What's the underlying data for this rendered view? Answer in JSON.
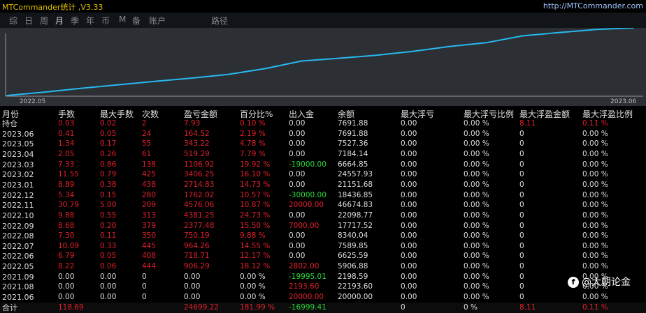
{
  "app": {
    "title": "MTCommander统计 ,V3.33",
    "link": "http://MTCommander.com"
  },
  "tabs": [
    {
      "label": "综"
    },
    {
      "label": "日"
    },
    {
      "label": "周"
    },
    {
      "label": "月"
    },
    {
      "label": "季"
    },
    {
      "label": "年"
    },
    {
      "label": "币"
    },
    {
      "label": "M"
    },
    {
      "label": "备"
    },
    {
      "label": "账户"
    },
    {
      "label": "路径"
    }
  ],
  "active_tab": "月",
  "chart_data": {
    "type": "line",
    "title": "",
    "xlabel": "",
    "ylabel": "",
    "x_ticks": [
      "2022.05",
      "2023.06"
    ],
    "series": [
      {
        "values": [
          0.0,
          0.041,
          0.09,
          0.133,
          0.177,
          0.218,
          0.265,
          0.337,
          0.434,
          0.468,
          0.505,
          0.554,
          0.615,
          0.663,
          0.75,
          0.792,
          0.831,
          0.85
        ]
      }
    ],
    "grid": false,
    "colors": {
      "line": "#27b8f0",
      "background": "#2c2f33"
    }
  },
  "table": {
    "headers": [
      "月份",
      "手数",
      "最大手数",
      "次数",
      "盈亏金额",
      "百分比%",
      "出入金",
      "余额",
      "最大浮亏",
      "最大浮亏比例",
      "最大浮盈金额",
      "最大浮盈比例"
    ],
    "rows": [
      [
        "持仓",
        "0.03",
        "0.02",
        "2",
        "7.93",
        "0.10 %",
        "0.00",
        "7691.88",
        "0.00",
        "0.00 %",
        "8.11",
        "0.11 %"
      ],
      [
        "2023.06",
        "0.41",
        "0.05",
        "24",
        "164.52",
        "2.19 %",
        "0.00",
        "7691.88",
        "0.00",
        "0.00 %",
        "0",
        "0.00 %"
      ],
      [
        "2023.05",
        "1.34",
        "0.17",
        "55",
        "343.22",
        "4.78 %",
        "0.00",
        "7527.36",
        "0.00",
        "0.00 %",
        "0",
        "0.00 %"
      ],
      [
        "2023.04",
        "2.05",
        "0.26",
        "61",
        "519.29",
        "7.79 %",
        "0.00",
        "7184.14",
        "0.00",
        "0.00 %",
        "0",
        "0.00 %"
      ],
      [
        "2023.03",
        "7.33",
        "0.86",
        "138",
        "1106.92",
        "19.92 %",
        "-19000.00",
        "6664.85",
        "0.00",
        "0.00 %",
        "0",
        "0.00 %"
      ],
      [
        "2023.02",
        "11.55",
        "0.79",
        "425",
        "3406.25",
        "16.10 %",
        "0.00",
        "24557.93",
        "0.00",
        "0.00 %",
        "0",
        "0.00 %"
      ],
      [
        "2023.01",
        "8.89",
        "0.38",
        "438",
        "2714.83",
        "14.73 %",
        "0.00",
        "21151.68",
        "0.00",
        "0.00 %",
        "0",
        "0.00 %"
      ],
      [
        "2022.12",
        "5.34",
        "0.15",
        "280",
        "1762.02",
        "10.57 %",
        "-30000.00",
        "18436.85",
        "0.00",
        "0.00 %",
        "0",
        "0.00 %"
      ],
      [
        "2022.11",
        "30.79",
        "5.00",
        "209",
        "4576.06",
        "10.87 %",
        "20000.00",
        "46674.83",
        "0.00",
        "0.00 %",
        "0",
        "0.00 %"
      ],
      [
        "2022.10",
        "9.88",
        "0.55",
        "313",
        "4381.25",
        "24.73 %",
        "0.00",
        "22098.77",
        "0.00",
        "0.00 %",
        "0",
        "0.00 %"
      ],
      [
        "2022.09",
        "8.68",
        "0.20",
        "379",
        "2377.48",
        "15.50 %",
        "7000.00",
        "17717.52",
        "0.00",
        "0.00 %",
        "0",
        "0.00 %"
      ],
      [
        "2022.08",
        "7.30",
        "0.11",
        "350",
        "750.19",
        "9.88 %",
        "0.00",
        "8340.04",
        "0.00",
        "0.00 %",
        "0",
        "0.00 %"
      ],
      [
        "2022.07",
        "10.09",
        "0.33",
        "445",
        "964.26",
        "14.55 %",
        "0.00",
        "7589.85",
        "0.00",
        "0.00 %",
        "0",
        "0.00 %"
      ],
      [
        "2022.06",
        "6.79",
        "0.05",
        "408",
        "718.71",
        "12.17 %",
        "0.00",
        "6625.59",
        "0.00",
        "0.00 %",
        "0",
        "0.00 %"
      ],
      [
        "2022.05",
        "8.22",
        "0.06",
        "444",
        "906.29",
        "18.12 %",
        "2802.00",
        "5906.88",
        "0.00",
        "0.00 %",
        "0",
        "0.00 %"
      ],
      [
        "2021.09",
        "0.00",
        "0.00",
        "0",
        "0.00",
        "0.00 %",
        "-19995.01",
        "2198.59",
        "0.00",
        "0.00 %",
        "0",
        "0.00 %"
      ],
      [
        "2021.08",
        "0.00",
        "0.00",
        "0",
        "0.00",
        "0.00 %",
        "2193.60",
        "22193.60",
        "0.00",
        "0.00 %",
        "0",
        "0.00 %"
      ],
      [
        "2021.06",
        "0.00",
        "0.00",
        "0",
        "0.00",
        "0.00 %",
        "20000.00",
        "20000.00",
        "0.00",
        "0.00 %",
        "0",
        "0.00 %"
      ]
    ],
    "footer": [
      "合计",
      "118.69",
      "",
      "",
      "24699.22",
      "181.99 %",
      "-16999.41",
      "",
      "0",
      "0 %",
      "8.11",
      "0.11 %"
    ]
  },
  "watermark": {
    "icon": "camera-icon",
    "text": "@大朝论金"
  },
  "colors": {
    "title": "#e0c000",
    "link": "#9fc6ff",
    "positive": "#e0202a",
    "negative": "#2ad63a",
    "neutral": "#dddddd"
  }
}
